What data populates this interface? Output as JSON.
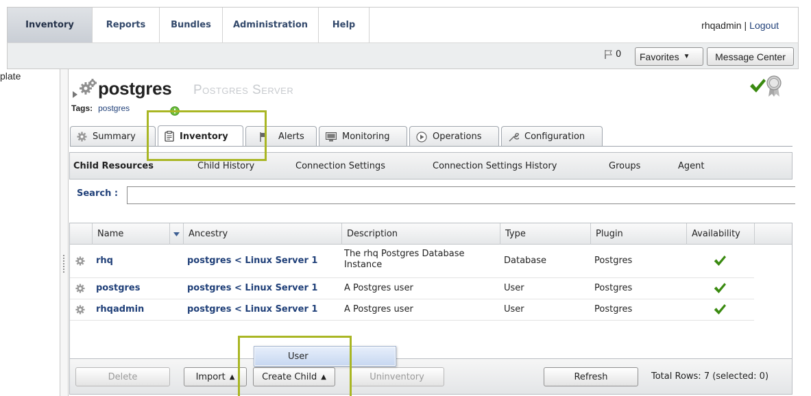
{
  "topnav": {
    "tabs": [
      {
        "label": "Inventory",
        "active": true
      },
      {
        "label": "Reports"
      },
      {
        "label": "Bundles"
      },
      {
        "label": "Administration"
      },
      {
        "label": "Help"
      }
    ],
    "user": "rhqadmin",
    "separator": "|",
    "logout": "Logout"
  },
  "subbar": {
    "flag_count": "0",
    "favorites_label": "Favorites",
    "message_center_label": "Message Center"
  },
  "left_panel": {
    "text": "plate"
  },
  "resource": {
    "name": "postgres",
    "type": "Postgres Server",
    "tags_label": "Tags:",
    "tags_value": "postgres",
    "availability": "up",
    "colors": {
      "check": "#3a8a10",
      "callout": "#a9b623"
    }
  },
  "main_tabs": [
    {
      "label": "Summary",
      "icon": "gear-icon"
    },
    {
      "label": "Inventory",
      "icon": "clipboard-icon",
      "active": true
    },
    {
      "label": "Alerts",
      "icon": "flag-icon"
    },
    {
      "label": "Monitoring",
      "icon": "monitor-icon"
    },
    {
      "label": "Operations",
      "icon": "play-icon"
    },
    {
      "label": "Configuration",
      "icon": "wrench-icon"
    }
  ],
  "sub_tabs": [
    {
      "label": "Child Resources",
      "active": true
    },
    {
      "label": "Child History"
    },
    {
      "label": "Connection Settings"
    },
    {
      "label": "Connection Settings History"
    },
    {
      "label": "Groups"
    },
    {
      "label": "Agent"
    }
  ],
  "search": {
    "label": "Search :",
    "value": ""
  },
  "grid": {
    "columns": [
      "Name",
      "Ancestry",
      "Description",
      "Type",
      "Plugin",
      "Availability"
    ],
    "rows": [
      {
        "name": "rhq",
        "ancestry": "postgres < Linux Server 1",
        "description": "The rhq Postgres Database Instance",
        "type": "Database",
        "plugin": "Postgres",
        "availability": "up"
      },
      {
        "name": "postgres",
        "ancestry": "postgres < Linux Server 1",
        "description": "A Postgres user",
        "type": "User",
        "plugin": "Postgres",
        "availability": "up"
      },
      {
        "name": "rhqadmin",
        "ancestry": "postgres < Linux Server 1",
        "description": "A Postgres user",
        "type": "User",
        "plugin": "Postgres",
        "availability": "up"
      }
    ]
  },
  "toolbar": {
    "delete": "Delete",
    "import": "Import",
    "create_child": "Create Child",
    "uninventory": "Uninventory",
    "refresh": "Refresh",
    "total_rows": "Total Rows: 7 (selected: 0)"
  },
  "create_menu": {
    "items": [
      "User"
    ]
  }
}
